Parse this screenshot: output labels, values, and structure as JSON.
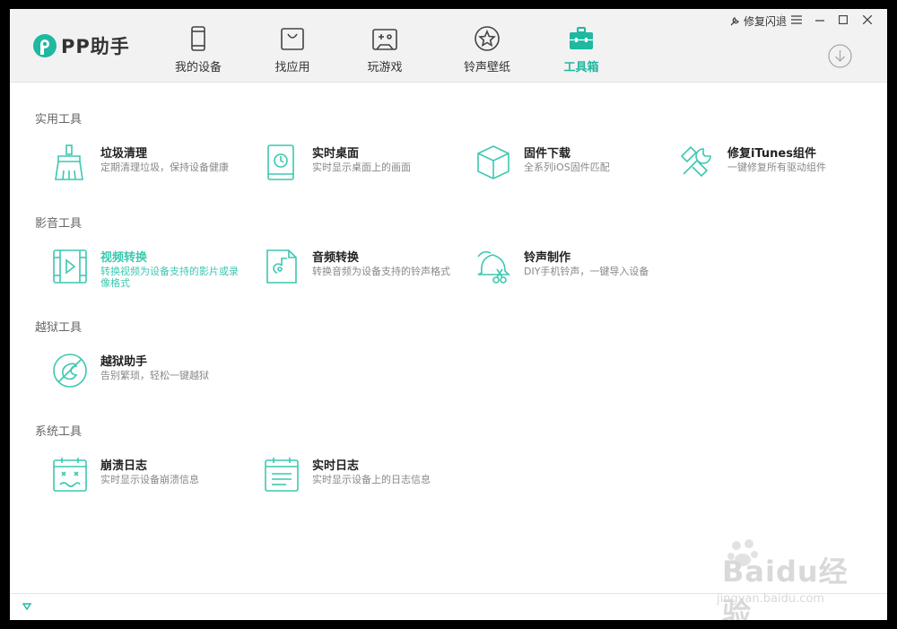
{
  "app": {
    "logo_text": "PP助手"
  },
  "nav": [
    {
      "label": "我的设备",
      "icon": "phone-icon"
    },
    {
      "label": "找应用",
      "icon": "bag-icon"
    },
    {
      "label": "玩游戏",
      "icon": "gamepad-icon"
    },
    {
      "label": "铃声壁纸",
      "icon": "star-icon"
    },
    {
      "label": "工具箱",
      "icon": "toolbox-icon",
      "active": true
    }
  ],
  "topbar": {
    "repair_label": "修复闪退"
  },
  "sections": [
    {
      "title": "实用工具",
      "tools": [
        {
          "name": "垃圾清理",
          "desc": "定期清理垃圾，保持设备健康",
          "icon": "broom-icon"
        },
        {
          "name": "实时桌面",
          "desc": "实时显示桌面上的画面",
          "icon": "tablet-clock-icon"
        },
        {
          "name": "固件下载",
          "desc": "全系列iOS固件匹配",
          "icon": "cube-icon"
        },
        {
          "name": "修复iTunes组件",
          "desc": "一键修复所有驱动组件",
          "icon": "wrench-icon"
        }
      ]
    },
    {
      "title": "影音工具",
      "tools": [
        {
          "name": "视频转换",
          "desc": "转换视频为设备支持的影片或录像格式",
          "icon": "film-icon",
          "highlighted": true
        },
        {
          "name": "音频转换",
          "desc": "转换音频为设备支持的铃声格式",
          "icon": "audio-file-icon"
        },
        {
          "name": "铃声制作",
          "desc": "DIY手机铃声，一键导入设备",
          "icon": "bell-scissors-icon"
        }
      ]
    },
    {
      "title": "越狱工具",
      "tools": [
        {
          "name": "越狱助手",
          "desc": "告别繁琐，轻松一键越狱",
          "icon": "jailbreak-icon"
        }
      ]
    },
    {
      "title": "系统工具",
      "tools": [
        {
          "name": "崩溃日志",
          "desc": "实时显示设备崩溃信息",
          "icon": "crash-log-icon"
        },
        {
          "name": "实时日志",
          "desc": "实时显示设备上的日志信息",
          "icon": "log-icon"
        }
      ]
    }
  ],
  "watermark": {
    "text": "Baidu经验",
    "sub": "jingyan.baidu.com"
  },
  "colors": {
    "accent": "#1fb8a0",
    "icon_stroke": "#3cc8b0"
  }
}
